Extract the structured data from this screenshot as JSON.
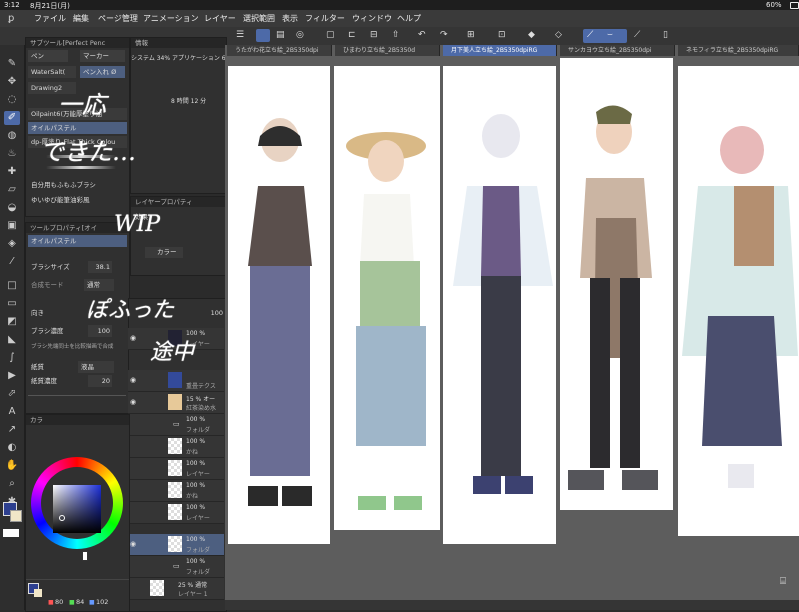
{
  "status": {
    "time": "3:12",
    "date": "8月21日(月)",
    "battery": "60%"
  },
  "menu": [
    "ファイル",
    "編集",
    "ページ管理",
    "アニメーション",
    "レイヤー",
    "選択範囲",
    "表示",
    "フィルター",
    "ウィンドウ",
    "ヘルプ"
  ],
  "subtool": {
    "header": "サブツール[Perfect Penc",
    "info": "情報",
    "tabs": [
      "ペン",
      "マーカー"
    ],
    "rows": [
      "WaterSalt(",
      "ペン入れ Ø",
      "Drawing2",
      "Oilpaint6(万能厚塗り油",
      "オイルパステル",
      "dp-厚塗り-Flat Thick Colou",
      "自分用もふもふブラシ",
      "ゆいゆび能筆油彩風"
    ],
    "system_info": "システム 34%  アプリケーション 68%",
    "time_info": "8 時間 12 分",
    "handwriting": [
      "一応",
      "できた…",
      "WIP",
      "ぽふった",
      "途中"
    ]
  },
  "toolprop": {
    "header": "ツールプロパティ[オイ",
    "brush_name": "オイルパステル",
    "brush_size_label": "ブラシサイズ",
    "brush_size": "38.1",
    "blend_mode_label": "合成モード",
    "blend_mode": "通常",
    "direction_label": "向き",
    "density_label": "ブラシ濃度",
    "density": "100",
    "checkbox_label": "ブラシ先端同士を比較描画で合成",
    "paper_label": "紙質",
    "paper_value": "液晶",
    "paper_density_label": "紙質濃度",
    "paper_density": "20"
  },
  "layerprop": {
    "header": "レイヤープロパティ",
    "effect_label": "効果",
    "color_label": "カラー"
  },
  "layers": [
    {
      "pct": "100 %",
      "name": "レイヤー"
    },
    {
      "pct": "",
      "name": "重畳テクス"
    },
    {
      "pct": "15 %  オー",
      "name": "紅茶染め水"
    },
    {
      "pct": "100 %",
      "name": "フォルダ"
    },
    {
      "pct": "100 %",
      "name": "かね"
    },
    {
      "pct": "100 %",
      "name": "レイヤー"
    },
    {
      "pct": "100 %",
      "name": "かね"
    },
    {
      "pct": "100 %",
      "name": "レイヤー"
    },
    {
      "pct": "100 %",
      "name": "フォルダ"
    },
    {
      "pct": "100 %",
      "name": "フォルダ"
    },
    {
      "pct": "25 %  通常",
      "name": "レイヤー 1"
    }
  ],
  "layer_opacity": "100",
  "color": {
    "r": "80",
    "g": "84",
    "b": "102",
    "main": "#2d3f8f"
  },
  "color_panel_title": "カラ",
  "doc_tabs": [
    "うたがわ花立ち絵_2B5350dpi",
    "ひまわり立ち絵_2B5350d",
    "月下美人立ち絵_2B5350dpiRG",
    "サンカヨウ立ち絵_2B5350dpi",
    "ネモフィラ立ち絵_2B5350dpiRG"
  ],
  "colors": {
    "accent": "#4d6aa8",
    "panel": "#303030",
    "canvas_bg": "#5d5d5d"
  }
}
